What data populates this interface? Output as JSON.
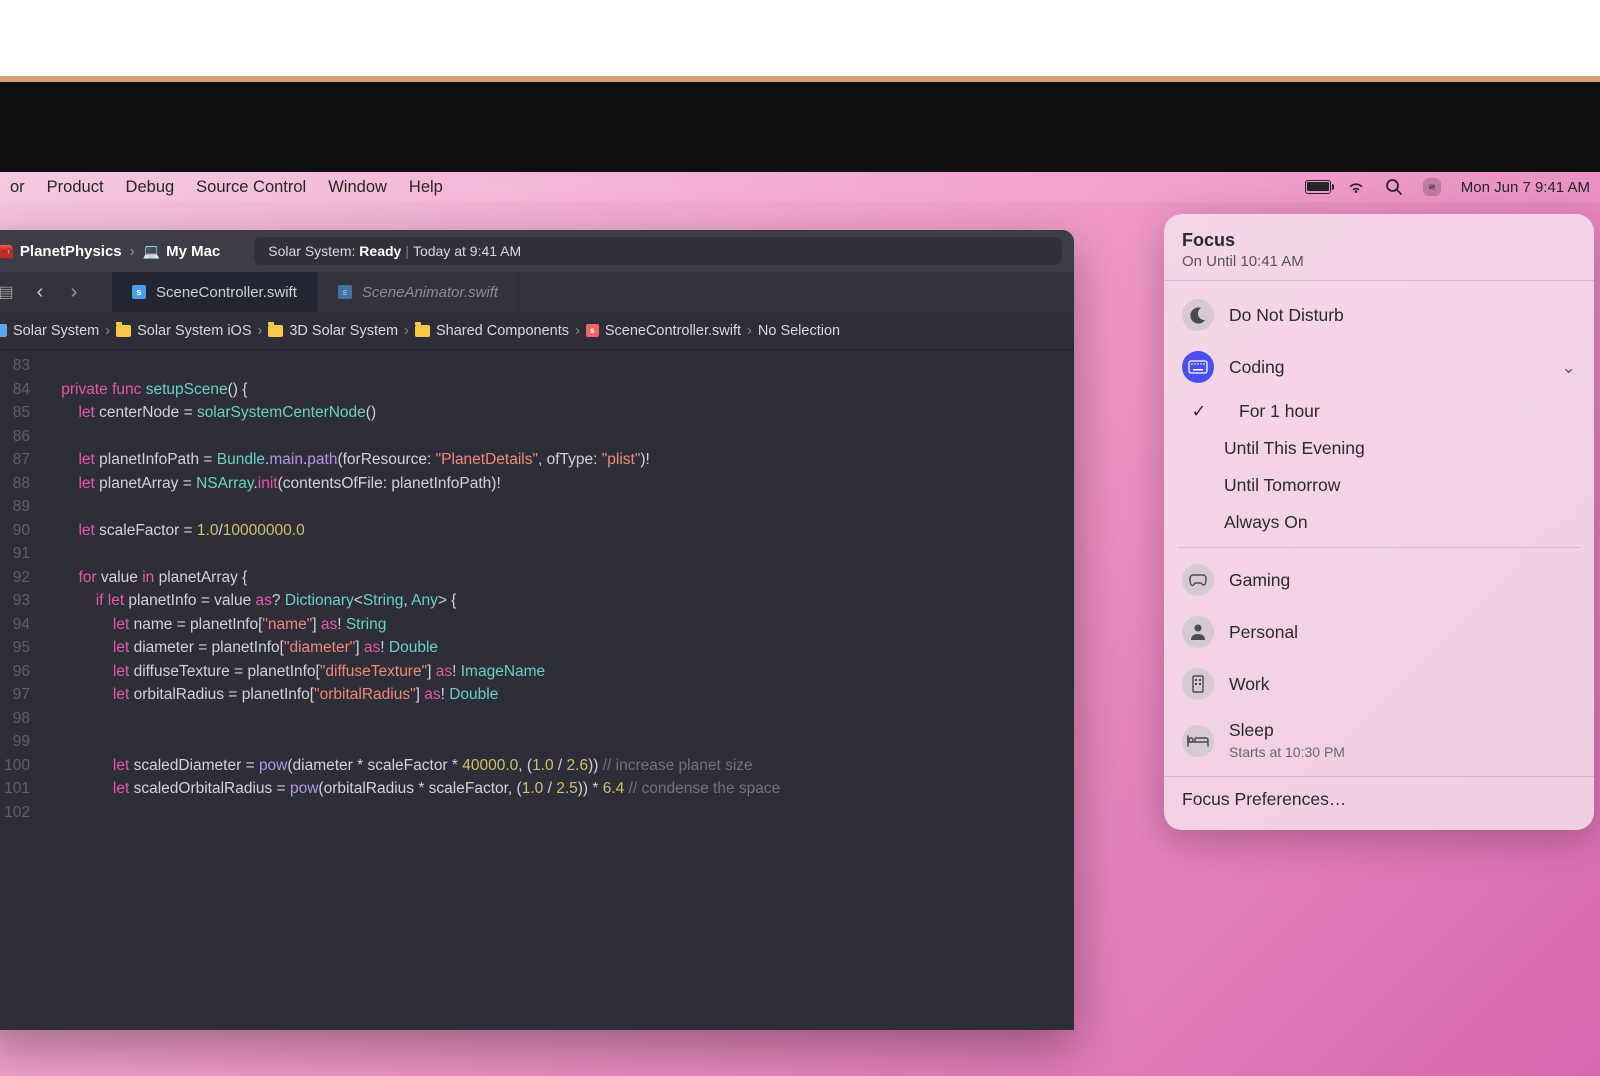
{
  "menubar": {
    "items": [
      "or",
      "Product",
      "Debug",
      "Source Control",
      "Window",
      "Help"
    ],
    "clock": "Mon Jun 7  9:41 AM"
  },
  "xcode": {
    "scheme": "PlanetPhysics",
    "target": "My Mac",
    "status_project": "Solar System:",
    "status_state": "Ready",
    "status_time": "Today at 9:41 AM",
    "tabs": {
      "active": "SceneController.swift",
      "inactive": "SceneAnimator.swift"
    },
    "bc": [
      "Solar System",
      "Solar System iOS",
      "3D Solar System",
      "Shared Components",
      "SceneController.swift",
      "No Selection"
    ]
  },
  "code": {
    "rows": [
      {
        "n": "83",
        "html": ""
      },
      {
        "n": "84",
        "html": "    <span class='kw'>private</span> <span class='kw'>func</span> <span class='fn'>setupScene</span>() {"
      },
      {
        "n": "85",
        "html": "        <span class='kw'>let</span> centerNode = <span class='fn'>solarSystemCenterNode</span>()"
      },
      {
        "n": "86",
        "html": ""
      },
      {
        "n": "87",
        "html": "        <span class='kw'>let</span> planetInfoPath = <span class='typ'>Bundle</span>.<span class='call'>main</span>.<span class='call'>path</span>(forResource: <span class='str'>\"PlanetDetails\"</span>, ofType: <span class='str'>\"plist\"</span>)!"
      },
      {
        "n": "88",
        "html": "        <span class='kw'>let</span> planetArray = <span class='typ'>NSArray</span>.<span class='kw'>init</span>(contentsOfFile: planetInfoPath)!"
      },
      {
        "n": "89",
        "html": ""
      },
      {
        "n": "90",
        "html": "        <span class='kw'>let</span> scaleFactor = <span class='num'>1.0</span>/<span class='num'>10000000.0</span>"
      },
      {
        "n": "91",
        "html": ""
      },
      {
        "n": "92",
        "html": "        <span class='kw'>for</span> value <span class='kw'>in</span> planetArray {"
      },
      {
        "n": "93",
        "html": "            <span class='kw'>if</span> <span class='kw'>let</span> planetInfo = value <span class='kw'>as</span>? <span class='typ'>Dictionary</span>&lt;<span class='typ'>String</span>, <span class='typ'>Any</span>&gt; {"
      },
      {
        "n": "94",
        "html": "                <span class='kw'>let</span> name = planetInfo[<span class='str'>\"name\"</span>] <span class='kw'>as</span>! <span class='typ'>String</span>"
      },
      {
        "n": "95",
        "html": "                <span class='kw'>let</span> diameter = planetInfo[<span class='str'>\"diameter\"</span>] <span class='kw'>as</span>! <span class='typ'>Double</span>"
      },
      {
        "n": "96",
        "html": "                <span class='kw'>let</span> diffuseTexture = planetInfo[<span class='str'>\"diffuseTexture\"</span>] <span class='kw'>as</span>! <span class='typ'>ImageName</span>"
      },
      {
        "n": "97",
        "html": "                <span class='kw'>let</span> orbitalRadius = planetInfo[<span class='str'>\"orbitalRadius\"</span>] <span class='kw'>as</span>! <span class='typ'>Double</span>"
      },
      {
        "n": "98",
        "html": ""
      },
      {
        "n": "99",
        "html": ""
      },
      {
        "n": "100",
        "html": "                <span class='kw'>let</span> scaledDiameter = <span class='call'>pow</span>(diameter * scaleFactor * <span class='num'>40000.0</span>, (<span class='num'>1.0</span> / <span class='num'>2.6</span>)) <span class='cmt'>// increase planet size</span>"
      },
      {
        "n": "101",
        "html": "                <span class='kw'>let</span> scaledOrbitalRadius = <span class='call'>pow</span>(orbitalRadius * scaleFactor, (<span class='num'>1.0</span> / <span class='num'>2.5</span>)) * <span class='num'>6.4</span> <span class='cmt'>// condense the space</span>"
      },
      {
        "n": "102",
        "html": ""
      }
    ]
  },
  "focus": {
    "title": "Focus",
    "subtitle": "On Until 10:41 AM",
    "dnd": "Do Not Disturb",
    "coding": "Coding",
    "opts": [
      "For 1 hour",
      "Until This Evening",
      "Until Tomorrow",
      "Always On"
    ],
    "gaming": "Gaming",
    "personal": "Personal",
    "work": "Work",
    "sleep": "Sleep",
    "sleep_sub": "Starts at 10:30 PM",
    "prefs": "Focus Preferences…"
  }
}
